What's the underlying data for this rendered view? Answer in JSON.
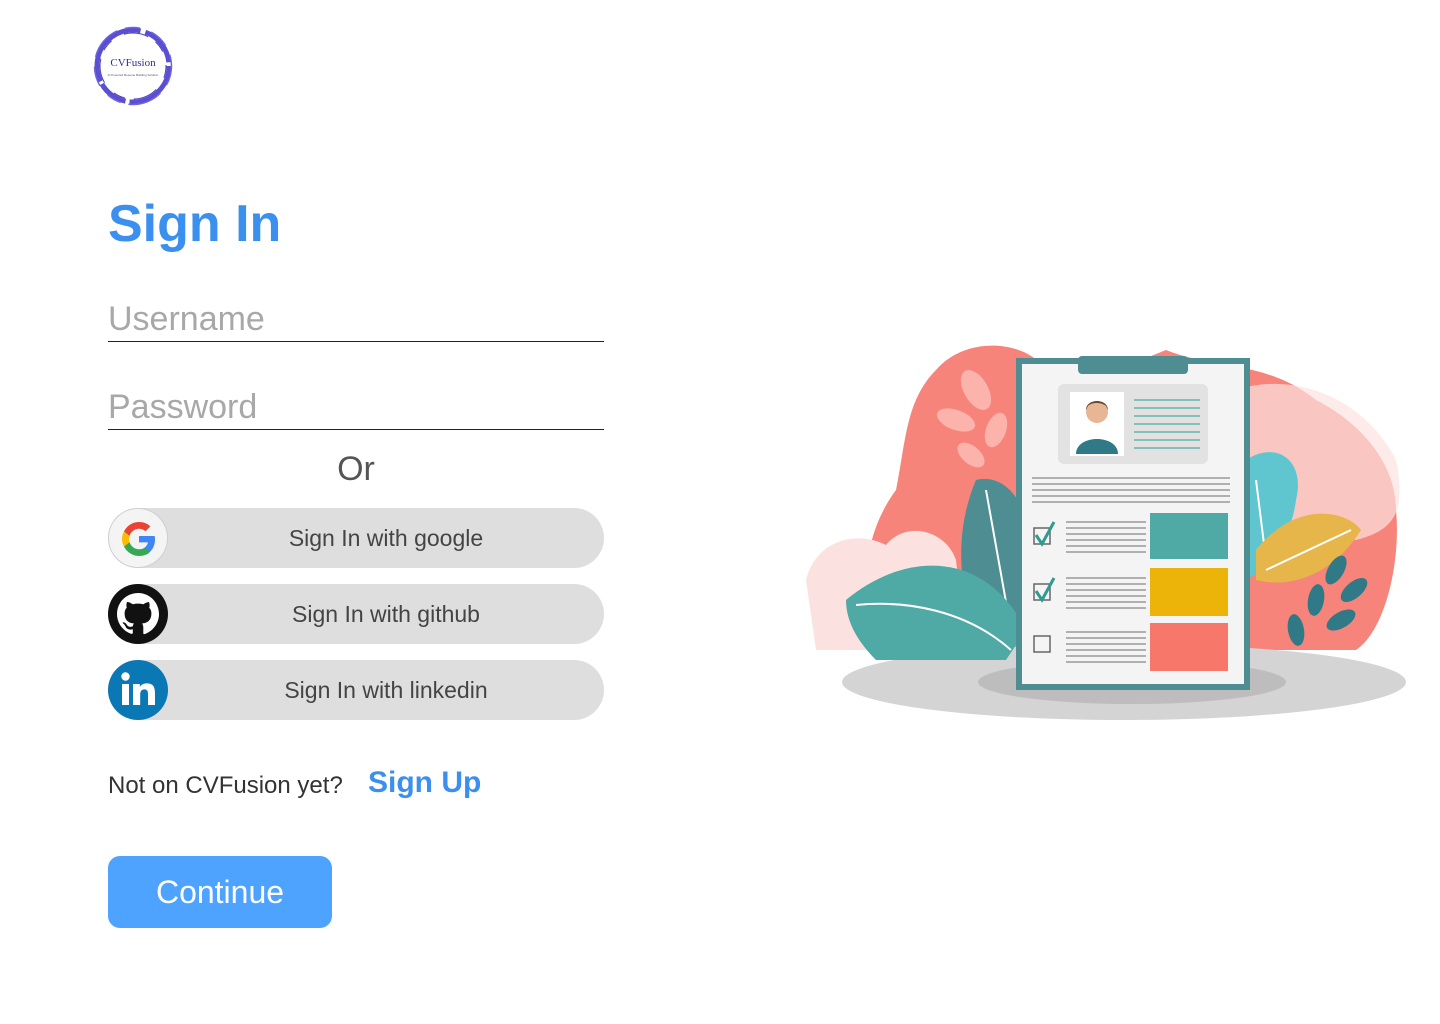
{
  "brand": {
    "logo_text": "CVFusion",
    "logo_tagline": "AI Powered Resume Building Solution",
    "logo_icon": "brush-ring-logo"
  },
  "signin": {
    "title": "Sign In",
    "username_placeholder": "Username",
    "password_placeholder": "Password",
    "or_label": "Or"
  },
  "social": {
    "google_label": "Sign In with google",
    "github_label": "Sign In with github",
    "linkedin_label": "Sign In with linkedin"
  },
  "signup": {
    "question": "Not on CVFusion yet?",
    "link": "Sign Up"
  },
  "actions": {
    "continue_label": "Continue"
  },
  "colors": {
    "accent": "#3b8fef",
    "button": "#4da3ff",
    "social_bg": "#dedede",
    "linkedin": "#0a78b5"
  },
  "illustration": {
    "icon": "resume-checklist-illustration"
  }
}
